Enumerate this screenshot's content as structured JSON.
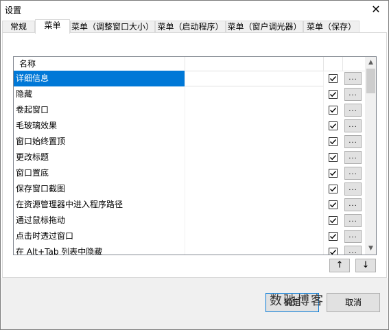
{
  "window": {
    "title": "设置",
    "close_glyph": "✕"
  },
  "tabs": [
    {
      "label": "常规",
      "active": false
    },
    {
      "label": "菜单",
      "active": true
    },
    {
      "label": "菜单（调整窗口大小）",
      "active": false
    },
    {
      "label": "菜单（启动程序）",
      "active": false
    },
    {
      "label": "菜单（窗户调光器）",
      "active": false
    },
    {
      "label": "菜单（保存）",
      "active": false
    }
  ],
  "list": {
    "header_name": "名称",
    "rows": [
      {
        "name": "详细信息",
        "checked": true,
        "selected": true
      },
      {
        "name": "隐藏",
        "checked": true,
        "selected": false
      },
      {
        "name": "卷起窗口",
        "checked": true,
        "selected": false
      },
      {
        "name": "毛玻璃效果",
        "checked": true,
        "selected": false
      },
      {
        "name": "窗口始终置顶",
        "checked": true,
        "selected": false
      },
      {
        "name": "更改标题",
        "checked": true,
        "selected": false
      },
      {
        "name": "窗口置底",
        "checked": true,
        "selected": false
      },
      {
        "name": "保存窗口截图",
        "checked": true,
        "selected": false
      },
      {
        "name": "在资源管理器中进入程序路径",
        "checked": true,
        "selected": false
      },
      {
        "name": "通过鼠标拖动",
        "checked": true,
        "selected": false
      },
      {
        "name": "点击时透过窗口",
        "checked": true,
        "selected": false
      },
      {
        "name": "在 Alt+Tab 列表中隐藏",
        "checked": true,
        "selected": false
      }
    ],
    "dots_label": "...",
    "scroll_up_glyph": "▲",
    "scroll_down_glyph": "▼"
  },
  "move_up_glyph": "↑",
  "move_down_glyph": "↓",
  "footer": {
    "ok_label": "确定",
    "cancel_label": "取消"
  },
  "watermark": "数驰博客",
  "colors": {
    "selection": "#0078d7",
    "button_face": "#e1e1e1",
    "footer_bg": "#f0f0f0"
  }
}
